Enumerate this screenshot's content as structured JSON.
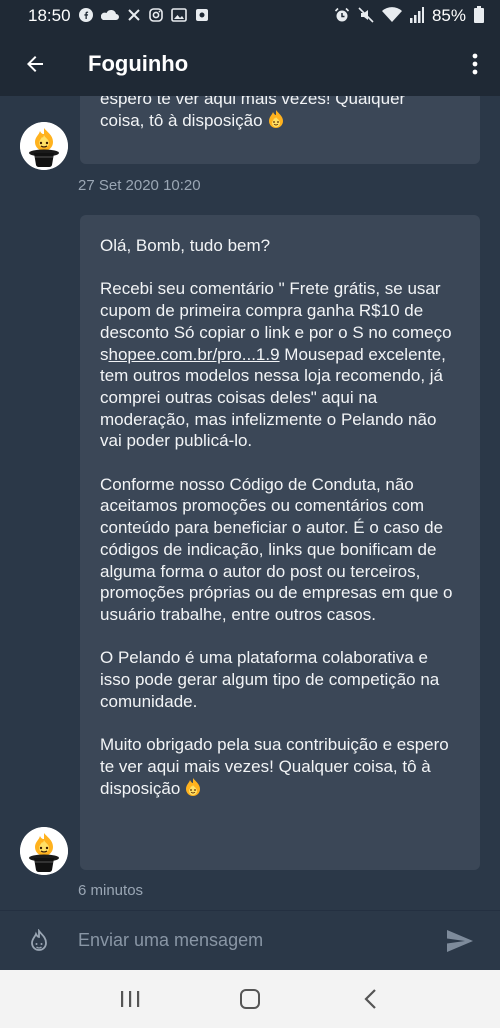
{
  "status_bar": {
    "time": "18:50",
    "battery": "85%",
    "icons": [
      "facebook-icon",
      "cloud-icon",
      "mute-icon",
      "instagram-icon",
      "gallery-icon",
      "notification-icon",
      "alarm-icon",
      "vibrate-off-icon",
      "wifi-icon",
      "signal-icon",
      "battery-icon"
    ]
  },
  "app_bar": {
    "title": "Foguinho",
    "back_icon": "arrow-left-icon",
    "menu_icon": "more-vert-icon"
  },
  "messages": [
    {
      "partial": true,
      "lines": [
        "espero te ver aqui mais vezes! Qualquer",
        "coisa, tô à disposição"
      ],
      "timestamp": "27 Set 2020 10:20"
    },
    {
      "greeting": "Olá, Bomb, tudo bem?",
      "p2_before_link": "Recebi seu comentário \" Frete grátis, se usar cupom de primeira compra ganha R$10 de desconto  Só copiar o link e por o S no começo  s",
      "p2_link": "hopee.com.br/pro...1.9",
      "p2_after_link": "Mousepad excelente, tem outros modelos nessa loja recomendo, já comprei outras coisas deles\" aqui na moderação, mas infelizmente o Pelando não vai poder publicá-lo.",
      "p3": "Conforme nosso Código de Conduta, não aceitamos promoções ou comentários com conteúdo para beneficiar o autor. É o caso de códigos de indicação, links que bonificam de alguma forma o autor do post ou terceiros, promoções próprias ou de empresas em que o usuário trabalhe, entre outros casos.",
      "p4": "O Pelando é uma plataforma colaborativa e isso pode gerar algum tipo de competição na comunidade.",
      "p5": "Muito obrigado pela sua contribuição e espero te ver aqui mais vezes! Qualquer coisa, tô à disposição",
      "timestamp": "6 minutos"
    }
  ],
  "composer": {
    "placeholder": "Enviar uma mensagem",
    "value": ""
  },
  "colors": {
    "background": "#2b3848",
    "bar": "#1f2935",
    "bubble": "#3b4757",
    "muted_text": "#9aa6b4",
    "nav_background": "#f3f3f3"
  }
}
